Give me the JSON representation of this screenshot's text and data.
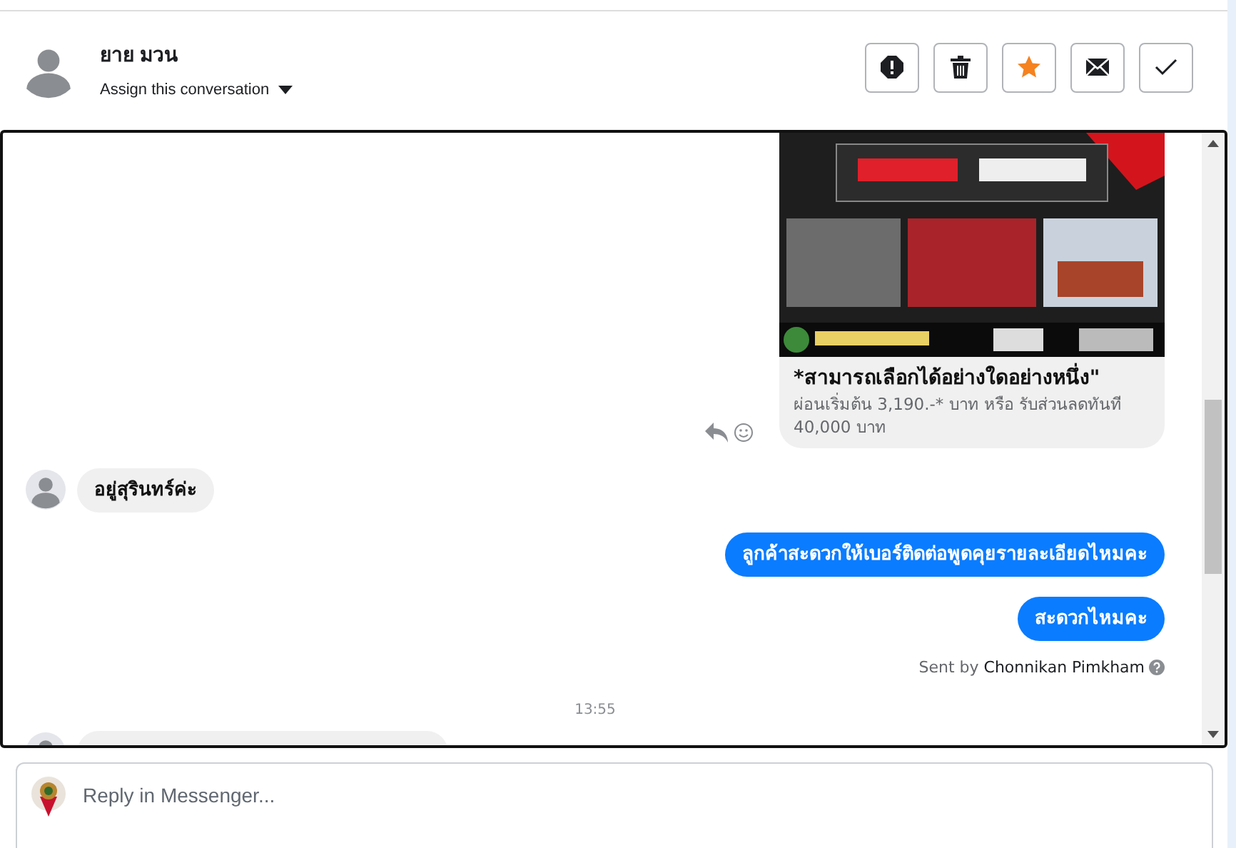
{
  "contact": {
    "name": "ยาย มวน",
    "assign_label": "Assign this conversation"
  },
  "actions": [
    {
      "kind": "spam",
      "on": false
    },
    {
      "kind": "delete",
      "on": false
    },
    {
      "kind": "star",
      "on": true
    },
    {
      "kind": "mail",
      "on": false
    },
    {
      "kind": "done",
      "on": false
    }
  ],
  "messages": [
    {
      "kind": "card",
      "outgoing": true,
      "title": "*สามารถเลือกได้อย่างใดอย่างหนึ่ง\"",
      "subtitle": "ผ่อนเริ่มต้น 3,190.-* บาท หรือ รับส่วนลดทันที 40,000 บาท"
    },
    {
      "kind": "text",
      "outgoing": false,
      "text": "อยู่สุรินทร์ค่ะ"
    },
    {
      "kind": "text",
      "outgoing": true,
      "text": "ลูกค้าสะดวกให้เบอร์ติดต่อพูดคุยรายละเอียดไหมคะ"
    },
    {
      "kind": "text",
      "outgoing": true,
      "text": "สะดวกไหมคะ"
    },
    {
      "kind": "sent_by",
      "prefix": "Sent by",
      "author": "Chonnikan Pimkham"
    },
    {
      "kind": "time",
      "text": "13:55"
    },
    {
      "kind": "partial",
      "outgoing": false
    }
  ],
  "composer": {
    "placeholder": "Reply in Messenger..."
  }
}
